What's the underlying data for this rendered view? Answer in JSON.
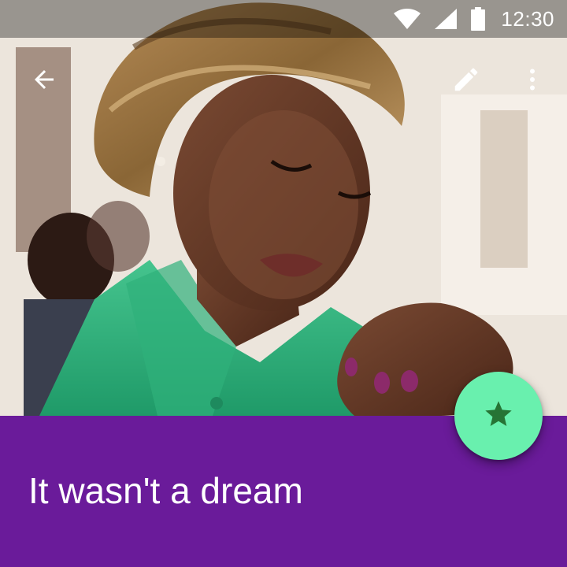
{
  "status_bar": {
    "time": "12:30",
    "icons": [
      "wifi-icon",
      "cell-signal-icon",
      "battery-icon"
    ]
  },
  "toolbar": {
    "back_icon": "arrow-back-icon",
    "edit_icon": "pencil-icon",
    "more_icon": "more-vert-icon"
  },
  "hero": {
    "image": "photo of a woman in a patterned headwrap and green top with clasped hands"
  },
  "title": "It wasn't a dream",
  "fab": {
    "icon": "star-icon"
  },
  "colors": {
    "title_band": "#6a1b9a",
    "fab": "#69f0ae",
    "fab_icon": "#1b5e20",
    "status_bar_overlay": "rgba(0,0,0,0.35)"
  }
}
